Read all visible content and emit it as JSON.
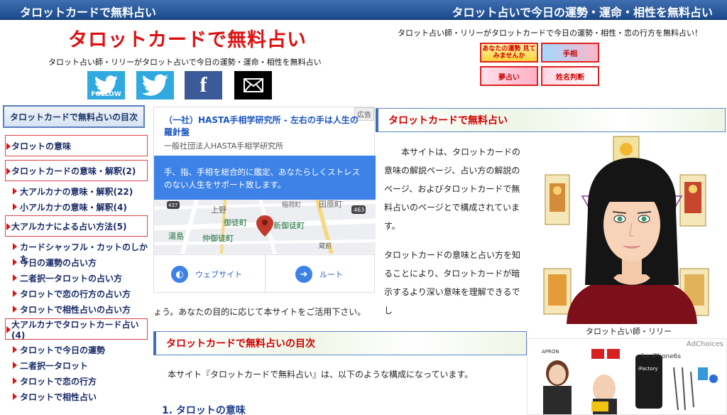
{
  "topbar": {
    "left": "タロットカードで無料占い",
    "right": "タロット占いで今日の運勢・運命・相性を無料占い"
  },
  "header": {
    "title": "タロットカードで無料占い",
    "description": "タロット占い師・リリーがタロット占いで今日の運勢・運命・相性を無料占い",
    "right_text": "タロット占い師・リリーがタロットカードで今日の運勢・相性・恋の行方を無料占い！",
    "follow_label": "FOLLOW",
    "banners": [
      "あなたの運勢 見てみませんか",
      "手相",
      "夢占い",
      "姓名判断"
    ]
  },
  "sidebar": {
    "title": "タロットカードで無料占いの目次",
    "groups": [
      {
        "label": "タロットの意味",
        "items": []
      },
      {
        "label": "タロットカードの意味・解釈(2)",
        "items": [
          "大アルカナの意味・解釈(22)",
          "小アルカナの意味・解釈(4)"
        ]
      },
      {
        "label": "大アルカナによる占い方法(5)",
        "items": [
          "カードシャッフル・カットのしかた",
          "今日の運勢の占い方",
          "二者択一タロットの占い方",
          "タロットで恋の行方の占い方",
          "タロットで相性占いの占い方"
        ]
      },
      {
        "label": "大アルカナでタロットカード占い(4)",
        "items": [
          "タロットで今日の運勢",
          "二者択一タロット",
          "タロットで恋の行方",
          "タロットで相性占い"
        ]
      }
    ]
  },
  "ad": {
    "badge": "広告",
    "title": "（一社）HASTA手相学研究所 - 左右の手は人生の羅針盤",
    "org": "一般社団法人HASTA手相学研究所",
    "blurb": "手、指、手相を総合的に鑑定、あなたらしくストレスのない人生をサポート致します。",
    "map_labels": [
      "上野",
      "御徒町",
      "仲御徒町",
      "湯島",
      "新御徒町",
      "田原町",
      "蔵前",
      "稲荷町",
      "463",
      "437"
    ],
    "website": "ウェブサイト",
    "route": "ルート"
  },
  "main": {
    "heading1": "タロットカードで無料占い",
    "p1": "本サイトは、タロットカードの意味の解説ページ、占い方の解説のページ、およびタロットカードで無料占いのページとで構成されています。",
    "p2": "タロットカードの意味と占い方を知ることにより、タロットカードが暗示するより深い意味を理解できるでし",
    "p2_end": "ょう。あなたの目的に応じて本サイトをご活用下さい。",
    "heading2": "タロットカードで無料占いの目次",
    "toc_intro": "本サイト『タロットカードで無料占い』は、以下のような構成になっています。",
    "section1": "1. タロットの意味",
    "portrait_caption": "タロット占い師・リリー"
  },
  "ad2": {
    "choices": "AdChoices",
    "brand": "APRON",
    "phone_label": "for iPhone6s",
    "phone_brand": "iFactory"
  },
  "colors": {
    "topbar": "#1b4a8c",
    "title_red": "#dd1111",
    "nav_text": "#1a2a66",
    "ad_blue": "#3d82e6"
  }
}
